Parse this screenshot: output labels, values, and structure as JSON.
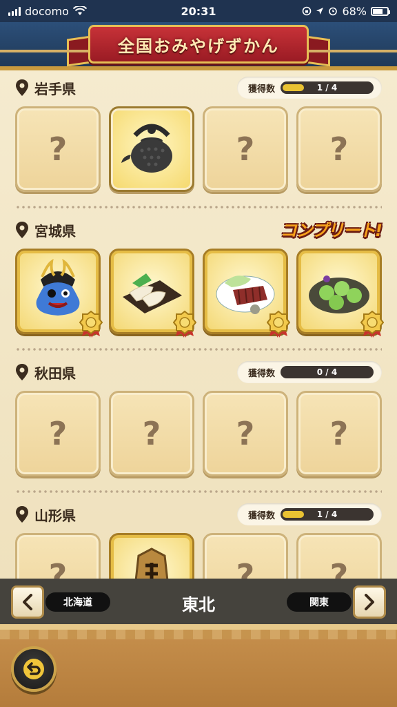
{
  "status_bar": {
    "carrier": "docomo",
    "time": "20:31",
    "battery": "68%",
    "battery_level": 0.68
  },
  "header": {
    "title": "全国おみやげずかん"
  },
  "sections": [
    {
      "prefecture": "岩手県",
      "progress_label": "獲得数",
      "progress_text": "1 / 4",
      "progress_fraction": 0.25,
      "complete": false,
      "cards": [
        {
          "state": "unknown",
          "label": "?"
        },
        {
          "state": "owned",
          "item": "iron-teapot"
        },
        {
          "state": "unknown",
          "label": "?"
        },
        {
          "state": "unknown",
          "label": "?"
        }
      ]
    },
    {
      "prefecture": "宮城県",
      "complete_label": "コンプリート!",
      "complete": true,
      "cards": [
        {
          "state": "complete",
          "item": "samurai-slime"
        },
        {
          "state": "complete",
          "item": "sasakamaboko"
        },
        {
          "state": "complete",
          "item": "beef-tongue"
        },
        {
          "state": "complete",
          "item": "zunda-mochi"
        }
      ]
    },
    {
      "prefecture": "秋田県",
      "progress_label": "獲得数",
      "progress_text": "0 / 4",
      "progress_fraction": 0,
      "complete": false,
      "cards": [
        {
          "state": "unknown",
          "label": "?"
        },
        {
          "state": "unknown",
          "label": "?"
        },
        {
          "state": "unknown",
          "label": "?"
        },
        {
          "state": "unknown",
          "label": "?"
        }
      ]
    },
    {
      "prefecture": "山形県",
      "progress_label": "獲得数",
      "progress_text": "1 / 4",
      "progress_fraction": 0.25,
      "complete": false,
      "cards": [
        {
          "state": "unknown",
          "label": "?"
        },
        {
          "state": "complete",
          "item": "shogi-piece"
        },
        {
          "state": "unknown",
          "label": "?"
        },
        {
          "state": "unknown",
          "label": "?"
        }
      ]
    }
  ],
  "nav": {
    "prev_region": "北海道",
    "current_region": "東北",
    "next_region": "関東"
  },
  "colors": {
    "header_blue": "#1f3958",
    "banner_red": "#c73238",
    "gold": "#e6bf55",
    "progress_fill": "#e9c232",
    "complete_orange": "#f7a21b"
  }
}
